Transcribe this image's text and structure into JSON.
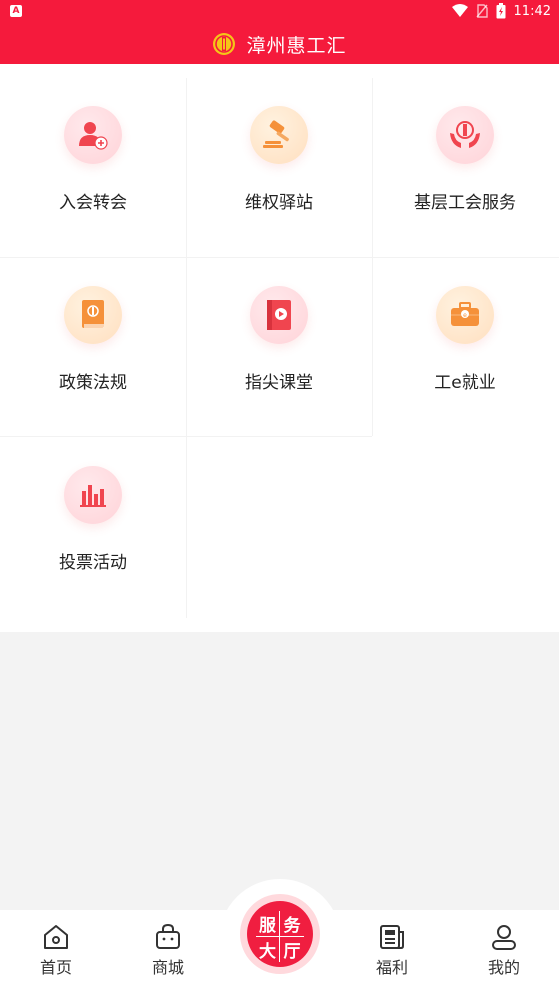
{
  "status_bar": {
    "time": "11:42",
    "left_icon_letter": "A"
  },
  "header": {
    "title": "漳州惠工汇"
  },
  "services": [
    {
      "label": "入会转会",
      "icon": "user-add-icon"
    },
    {
      "label": "维权驿站",
      "icon": "gavel-icon"
    },
    {
      "label": "基层工会服务",
      "icon": "hands-emblem-icon"
    },
    {
      "label": "政策法规",
      "icon": "book-icon"
    },
    {
      "label": "指尖课堂",
      "icon": "video-book-icon"
    },
    {
      "label": "工e就业",
      "icon": "briefcase-icon"
    },
    {
      "label": "投票活动",
      "icon": "bar-chart-icon"
    }
  ],
  "tabbar": {
    "home": "首页",
    "shop": "商城",
    "center": [
      "服",
      "务",
      "大",
      "厅"
    ],
    "welfare": "福利",
    "mine": "我的"
  },
  "colors": {
    "brand_red": "#f51a3c",
    "icon_red": "#f0454f",
    "icon_orange": "#f5913a"
  }
}
